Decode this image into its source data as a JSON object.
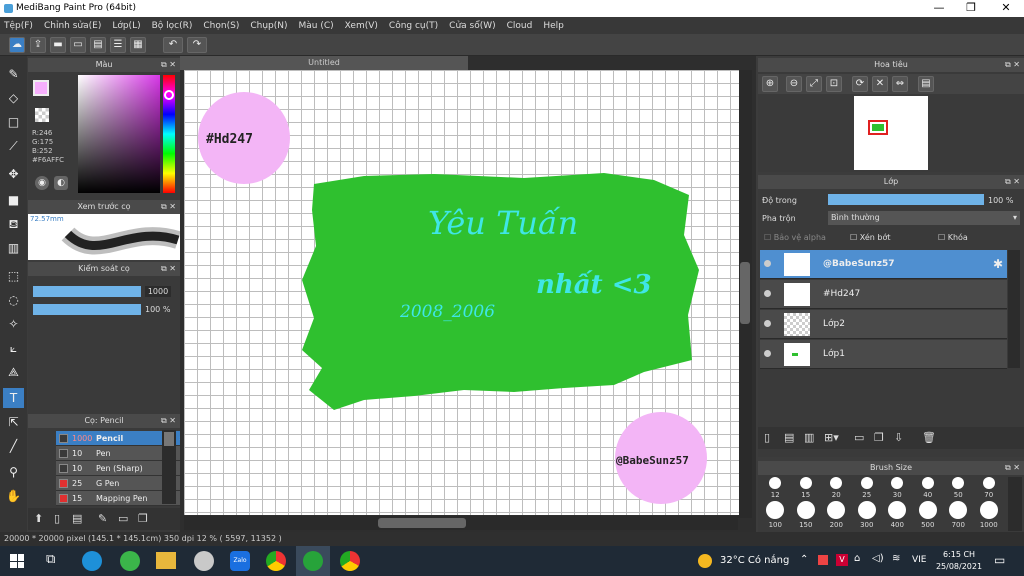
{
  "window": {
    "title": "MediBang Paint Pro (64bit)"
  },
  "menu": [
    "Tệp(F)",
    "Chỉnh sửa(E)",
    "Lớp(L)",
    "Bộ lọc(R)",
    "Chọn(S)",
    "Chụp(N)",
    "Màu (C)",
    "Xem(V)",
    "Công cụ(T)",
    "Cửa sổ(W)",
    "Cloud",
    "Help"
  ],
  "color_panel": {
    "title": "Màu",
    "r": "R:246",
    "g": "G:175",
    "b": "B:252",
    "hex": "#F6AFFC",
    "primary": "#f6affc",
    "secondary": "#3c63d0"
  },
  "brush_preview": {
    "title": "Xem trước cọ",
    "size": "72.57mm"
  },
  "brush_control": {
    "title": "Kiểm soát cọ",
    "size": "1000",
    "opacity": "100 %",
    "size_fill": 1.0,
    "opacity_fill": 1.0
  },
  "brush_list": {
    "title": "Cọ: Pencil",
    "items": [
      {
        "size": "1000",
        "name": "Pencil",
        "selected": true,
        "color": "#3a3a3a"
      },
      {
        "size": "10",
        "name": "Pen",
        "selected": false,
        "color": "#3a3a3a"
      },
      {
        "size": "10",
        "name": "Pen (Sharp)",
        "selected": false,
        "color": "#3a3a3a"
      },
      {
        "size": "25",
        "name": "G Pen",
        "selected": false,
        "color": "#e03030"
      },
      {
        "size": "15",
        "name": "Mapping Pen",
        "selected": false,
        "color": "#e03030"
      }
    ]
  },
  "canvas": {
    "tab": "Untitled",
    "bubble_left": "#Hd247",
    "bubble_right": "@BabeSunz57",
    "line1": "Yêu Tuấn",
    "line2": "nhất <3",
    "date": "2008_2006",
    "paint_color": "#2fc02f",
    "bubble_color": "#f3b5f6",
    "text_color": "#3fe6e6"
  },
  "navigator": {
    "title": "Hoa tiêu"
  },
  "layer_panel": {
    "title": "Lớp",
    "opacity_label": "Độ trong",
    "opacity_value": "100 %",
    "opacity_fill": 1.0,
    "blend_label": "Pha trộn",
    "blend_value": "Bình thường",
    "protect_alpha": "Bảo vệ alpha",
    "clipping": "Xén bớt",
    "lock": "Khóa",
    "layers": [
      {
        "name": "@BabeSunz57",
        "selected": true
      },
      {
        "name": "#Hd247",
        "selected": false
      },
      {
        "name": "Lớp2",
        "selected": false
      },
      {
        "name": "Lớp1",
        "selected": false
      }
    ]
  },
  "brush_size": {
    "title": "Brush Size",
    "row1": [
      "12",
      "15",
      "20",
      "25",
      "30",
      "40",
      "50",
      "70"
    ],
    "row2": [
      "100",
      "150",
      "200",
      "300",
      "400",
      "500",
      "700",
      "1000"
    ]
  },
  "status": {
    "text": "20000 * 20000 pixel   (145.1 * 145.1cm)   350 dpi   12 %   ( 5597, 11352 )"
  },
  "taskbar": {
    "weather": "32°C  Có nắng",
    "lang": "VIE",
    "time": "6:15 CH",
    "date": "25/08/2021"
  }
}
